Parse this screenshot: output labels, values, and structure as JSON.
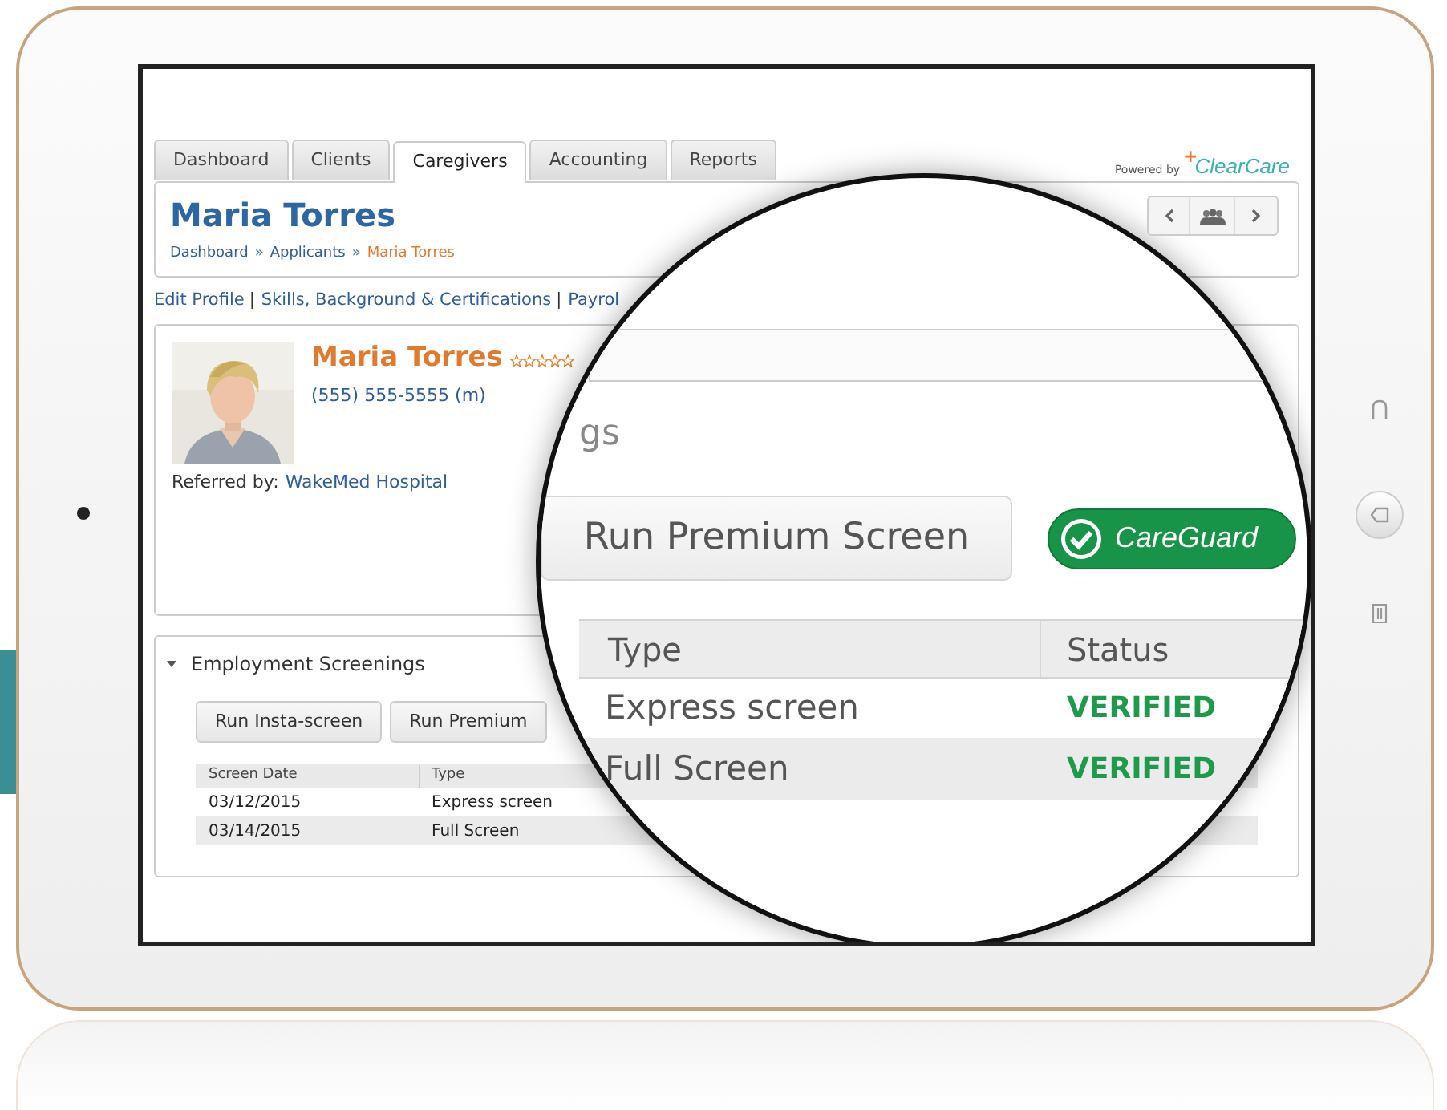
{
  "tabs": [
    {
      "label": "Dashboard",
      "selected": false
    },
    {
      "label": "Clients",
      "selected": false
    },
    {
      "label": "Caregivers",
      "selected": true
    },
    {
      "label": "Accounting",
      "selected": false
    },
    {
      "label": "Reports",
      "selected": false
    }
  ],
  "branding": {
    "prefix": "Powered by",
    "mark": "+",
    "name": "ClearCare"
  },
  "header": {
    "title": "Maria Torres",
    "separator": "»",
    "breadcrumb": [
      {
        "label": "Dashboard",
        "current": false
      },
      {
        "label": "Applicants",
        "current": false
      },
      {
        "label": "Maria Torres",
        "current": true
      }
    ]
  },
  "profile_links": {
    "separator": "|",
    "items": [
      "Edit Profile",
      "Skills, Background & Certifications",
      "Payrol"
    ]
  },
  "profile": {
    "name": "Maria Torres",
    "stars": 0,
    "phone": "(555) 555-5555 (m)",
    "referred_label": "Referred by:",
    "referred_value": "WakeMed Hospital"
  },
  "screenings": {
    "title": "Employment Screenings",
    "expanded": true,
    "buttons": [
      "Run Insta-screen",
      "Run Premium"
    ],
    "columns": [
      "Screen Date",
      "Type"
    ],
    "rows": [
      [
        "03/12/2015",
        "Express screen"
      ],
      [
        "03/14/2015",
        "Full Screen"
      ]
    ]
  },
  "magnifier": {
    "heading_fragment": "gs",
    "button": "Run Premium Screen",
    "badge": "CareGuard",
    "columns": [
      "Type",
      "Status"
    ],
    "rows": [
      {
        "type": "Express screen",
        "status": "VERIFIED"
      },
      {
        "type": "Full Screen",
        "status": "VERIFIED"
      }
    ]
  }
}
